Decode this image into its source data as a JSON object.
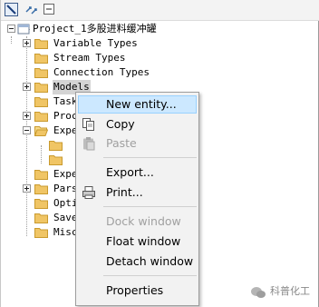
{
  "tree": {
    "root": "Project_1多股进料缓冲罐",
    "items": [
      {
        "label": "Variable Types"
      },
      {
        "label": "Stream Types"
      },
      {
        "label": "Connection Types"
      },
      {
        "label": "Models"
      },
      {
        "label": "Task"
      },
      {
        "label": "Proc"
      },
      {
        "label": "Expe"
      },
      {
        "label": ""
      },
      {
        "label": ""
      },
      {
        "label": "Expe"
      },
      {
        "label": "Pars"
      },
      {
        "label": "Opti"
      },
      {
        "label": "Save"
      },
      {
        "label": "Misc"
      }
    ]
  },
  "context_menu": {
    "items": [
      {
        "label": "New entity...",
        "state": "highlighted"
      },
      {
        "label": "Copy",
        "state": "enabled"
      },
      {
        "label": "Paste",
        "state": "disabled"
      },
      {
        "label": "Export...",
        "state": "enabled"
      },
      {
        "label": "Print...",
        "state": "enabled"
      },
      {
        "label": "Dock window",
        "state": "disabled"
      },
      {
        "label": "Float window",
        "state": "enabled"
      },
      {
        "label": "Detach window",
        "state": "enabled"
      },
      {
        "label": "Properties",
        "state": "enabled"
      }
    ]
  },
  "watermark": {
    "text": "科普化工"
  },
  "colors": {
    "folder": "#f0c565",
    "highlight": "#cce8ff",
    "highlight_border": "#99d1ff",
    "disabled_text": "#a0a0a0"
  }
}
